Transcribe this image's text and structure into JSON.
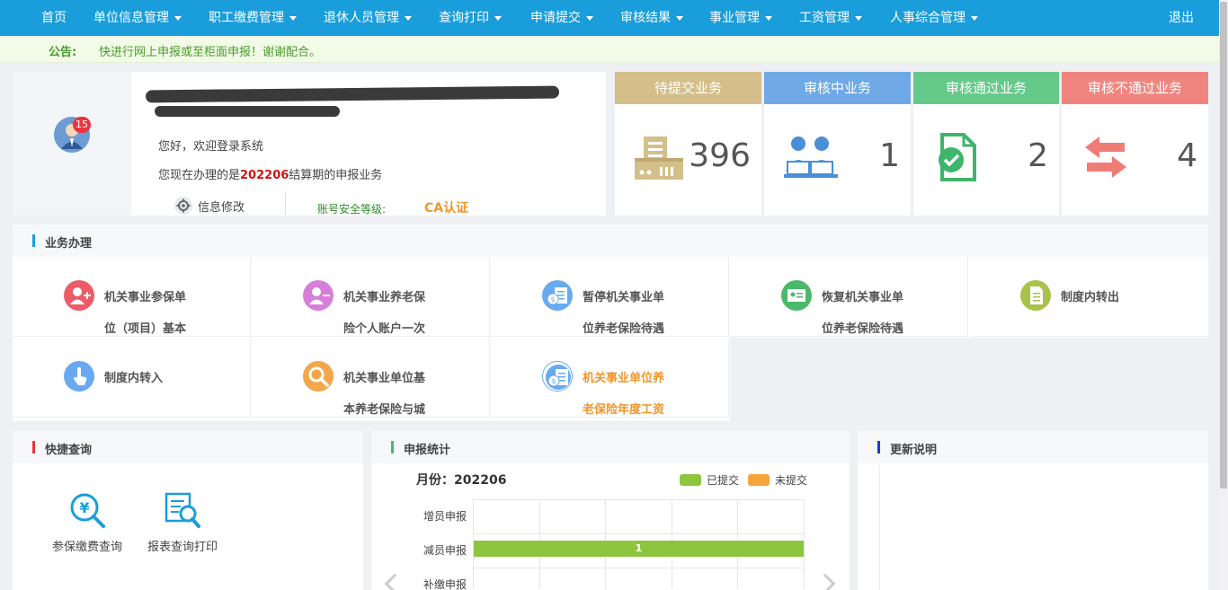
{
  "nav": {
    "items": [
      {
        "label": "首页",
        "dropdown": false
      },
      {
        "label": "单位信息管理",
        "dropdown": true
      },
      {
        "label": "职工缴费管理",
        "dropdown": true
      },
      {
        "label": "退休人员管理",
        "dropdown": true
      },
      {
        "label": "查询打印",
        "dropdown": true
      },
      {
        "label": "申请提交",
        "dropdown": true
      },
      {
        "label": "审核结果",
        "dropdown": true
      },
      {
        "label": "事业管理",
        "dropdown": true
      },
      {
        "label": "工资管理",
        "dropdown": true
      },
      {
        "label": "人事综合管理",
        "dropdown": true
      }
    ],
    "logout": "退出"
  },
  "notice": {
    "label": "公告:",
    "text": "快进行网上申报或至柜面申报！谢谢配合。"
  },
  "user": {
    "badge": "15",
    "welcome": "您好，欢迎登录系统",
    "period_prefix": "您现在办理的是",
    "period_value": "202206",
    "period_suffix": "结算期的申报业务",
    "edit_label": "信息修改",
    "security_label": "账号安全等级:",
    "security_value": "CA认证"
  },
  "stats_cards": [
    {
      "label": "待提交业务",
      "value": "396",
      "color": "#d4bf8a",
      "icon": "pending-doc-icon"
    },
    {
      "label": "审核中业务",
      "value": "1",
      "color": "#6fa9e6",
      "icon": "reviewers-icon"
    },
    {
      "label": "审核通过业务",
      "value": "2",
      "color": "#65c98a",
      "icon": "approved-doc-icon"
    },
    {
      "label": "审核不通过业务",
      "value": "4",
      "color": "#f0857f",
      "icon": "rejected-arrows-icon"
    }
  ],
  "business": {
    "title": "业务办理",
    "items": [
      {
        "line1": "机关事业参保单",
        "line2": "位（项目）基本",
        "color": "#ec5b67",
        "icon": "add-user-icon",
        "highlight": false
      },
      {
        "line1": "机关事业养老保",
        "line2": "险个人账户一次",
        "color": "#d77fd8",
        "icon": "remove-user-icon",
        "highlight": false
      },
      {
        "line1": "暂停机关事业单",
        "line2": "位养老保险待遇",
        "color": "#68a9ef",
        "icon": "money-list-icon",
        "highlight": false
      },
      {
        "line1": "恢复机关事业单",
        "line2": "位养老保险待遇",
        "color": "#4cb86a",
        "icon": "id-card-icon",
        "highlight": false
      },
      {
        "line1": "制度内转出",
        "line2": "",
        "color": "#a9c24a",
        "icon": "document-icon",
        "highlight": false
      },
      {
        "line1": "制度内转入",
        "line2": "",
        "color": "#68a9ef",
        "icon": "hand-pointer-icon",
        "highlight": false
      },
      {
        "line1": "机关事业单位基",
        "line2": "本养老保险与城",
        "color": "#f3a64a",
        "icon": "magnifier-icon",
        "highlight": false
      },
      {
        "line1": "机关事业单位养",
        "line2": "老保险年度工资",
        "color": "#68a9ef",
        "icon": "money-list-icon",
        "highlight": true
      }
    ]
  },
  "quick_query": {
    "title": "快捷查询",
    "items": [
      {
        "label": "参保缴费查询",
        "icon": "yuan-search-icon"
      },
      {
        "label": "报表查询打印",
        "icon": "report-search-icon"
      }
    ]
  },
  "report_stats": {
    "title": "申报统计",
    "month_label": "月份：202206",
    "legend": [
      {
        "label": "已提交",
        "color": "#8cc63f"
      },
      {
        "label": "未提交",
        "color": "#f5a53a"
      }
    ]
  },
  "chart_data": {
    "type": "bar",
    "orientation": "horizontal",
    "categories": [
      "增员申报",
      "减员申报",
      "补缴申报"
    ],
    "series": [
      {
        "name": "已提交",
        "values": [
          0,
          1,
          null
        ]
      },
      {
        "name": "未提交",
        "values": [
          0,
          0,
          null
        ]
      }
    ],
    "xlim": [
      0,
      1
    ],
    "grid": true
  },
  "updates": {
    "title": "更新说明"
  }
}
